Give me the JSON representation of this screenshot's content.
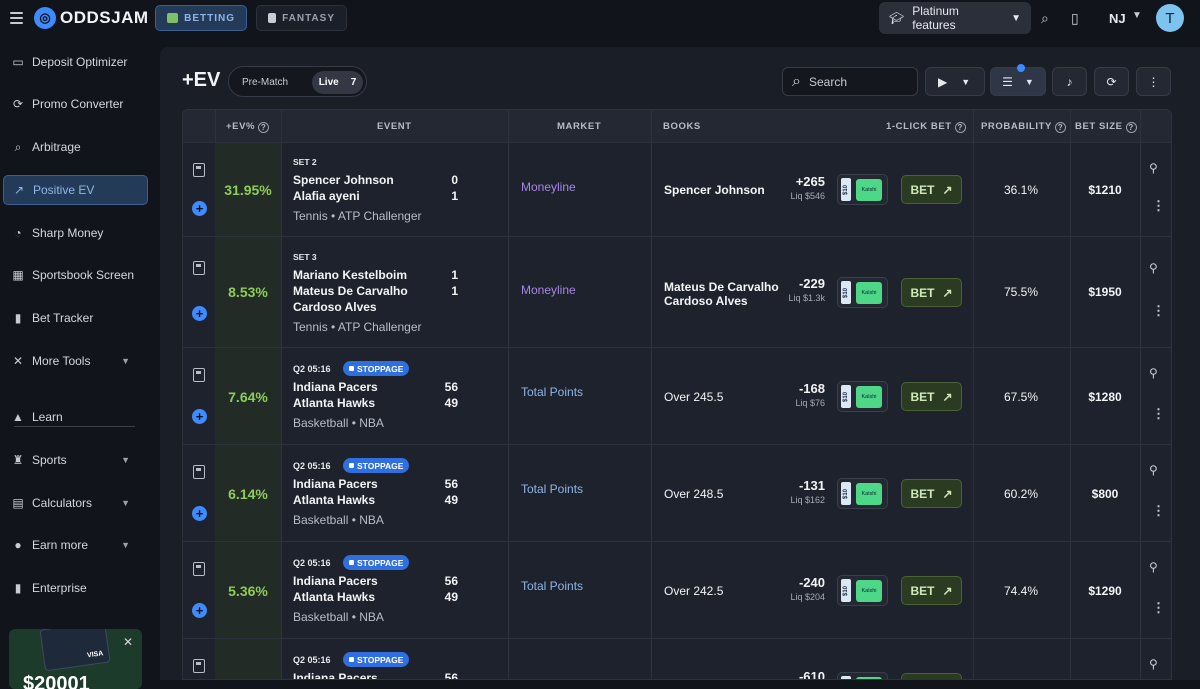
{
  "brand": {
    "name": "ODDSJAM"
  },
  "modes": {
    "betting": "BETTING",
    "fantasy": "FANTASY"
  },
  "topbar": {
    "platinum": "Platinum features",
    "state": "NJ",
    "avatar_initial": "T"
  },
  "sidebar": {
    "items": [
      {
        "label": "Deposit Optimizer",
        "icon": "wallet-icon"
      },
      {
        "label": "Promo Converter",
        "icon": "refresh-dollar-icon"
      },
      {
        "label": "Arbitrage",
        "icon": "search-dollar-icon"
      },
      {
        "label": "Positive EV",
        "icon": "trend-up-icon",
        "active": true
      },
      {
        "label": "Sharp Money",
        "icon": "money-bag-icon"
      },
      {
        "label": "Sportsbook Screen",
        "icon": "grid-icon"
      },
      {
        "label": "Bet Tracker",
        "icon": "bar-chart-icon"
      },
      {
        "label": "More Tools",
        "icon": "tools-icon",
        "expandable": true
      },
      {
        "label": "Learn",
        "icon": "graduation-cap-icon"
      },
      {
        "label": "Sports",
        "icon": "trophy-icon",
        "expandable": true
      },
      {
        "label": "Calculators",
        "icon": "calculator-icon",
        "expandable": true
      },
      {
        "label": "Earn more",
        "icon": "dollar-circle-icon",
        "expandable": true
      },
      {
        "label": "Enterprise",
        "icon": "bar-chart-icon"
      }
    ],
    "promo": {
      "amount": "$20001",
      "card_brand": "VISA"
    }
  },
  "page": {
    "title": "+EV",
    "toggle": {
      "pre_match": "Pre-Match",
      "live": "Live",
      "live_count": "7"
    },
    "search_placeholder": "Search"
  },
  "table": {
    "headers": {
      "ev": "+EV%",
      "event": "EVENT",
      "market": "MARKET",
      "books": "BOOKS",
      "one_click": "1-CLICK BET",
      "probability": "PROBABILITY",
      "bet_size": "BET SIZE"
    },
    "bet_label": "BET",
    "badge_10": "$10",
    "badge_book": "Kalshi",
    "rows": [
      {
        "ev": "31.95%",
        "period": "SET 2",
        "stoppage": "",
        "team1": "Spencer Johnson",
        "team2": "Alafia ayeni",
        "score1": "0",
        "score2": "1",
        "sport": "Tennis • ATP Challenger",
        "market": "Moneyline",
        "book": "Spencer Johnson",
        "odds": "+265",
        "liq": "Liq $546",
        "probability": "36.1%",
        "bet_size": "$1210"
      },
      {
        "ev": "8.53%",
        "period": "SET 3",
        "stoppage": "",
        "team1": "Mariano Kestelboim",
        "team2": "Mateus De Carvalho",
        "team2b": "Cardoso Alves",
        "score1": "1",
        "score2": "1",
        "sport": "Tennis • ATP Challenger",
        "market": "Moneyline",
        "book": "Mateus De Carvalho",
        "book2": "Cardoso Alves",
        "odds": "-229",
        "liq": "Liq $1.3k",
        "probability": "75.5%",
        "bet_size": "$1950"
      },
      {
        "ev": "7.64%",
        "period": "Q2 05:16",
        "stoppage": "STOPPAGE",
        "team1": "Indiana Pacers",
        "team2": "Atlanta Hawks",
        "score1": "56",
        "score2": "49",
        "sport": "Basketball • NBA",
        "market": "Total Points",
        "book": "Over 245.5",
        "odds": "-168",
        "liq": "Liq $76",
        "probability": "67.5%",
        "bet_size": "$1280"
      },
      {
        "ev": "6.14%",
        "period": "Q2 05:16",
        "stoppage": "STOPPAGE",
        "team1": "Indiana Pacers",
        "team2": "Atlanta Hawks",
        "score1": "56",
        "score2": "49",
        "sport": "Basketball • NBA",
        "market": "Total Points",
        "book": "Over 248.5",
        "odds": "-131",
        "liq": "Liq $162",
        "probability": "60.2%",
        "bet_size": "$800"
      },
      {
        "ev": "5.36%",
        "period": "Q2 05:16",
        "stoppage": "STOPPAGE",
        "team1": "Indiana Pacers",
        "team2": "Atlanta Hawks",
        "score1": "56",
        "score2": "49",
        "sport": "Basketball • NBA",
        "market": "Total Points",
        "book": "Over 242.5",
        "odds": "-240",
        "liq": "Liq $204",
        "probability": "74.4%",
        "bet_size": "$1290"
      },
      {
        "period": "Q2 05:16",
        "stoppage": "STOPPAGE",
        "team1": "Indiana Pacers",
        "score1": "56",
        "odds": "-610"
      }
    ]
  }
}
